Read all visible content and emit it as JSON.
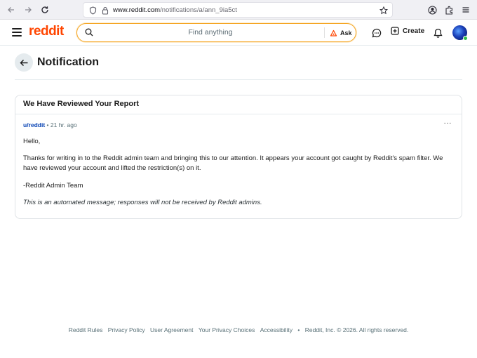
{
  "browser": {
    "url_host": "www.reddit.com",
    "url_path": "/notifications/a/ann_9ia5ct"
  },
  "header": {
    "logo": "reddit",
    "search_placeholder": "Find anything",
    "ask_label": "Ask",
    "create_label": "Create"
  },
  "page": {
    "title": "Notification"
  },
  "notification": {
    "title": "We Have Reviewed Your Report",
    "author": "u/reddit",
    "separator": "•",
    "time": "21 hr. ago",
    "more": "···",
    "greeting": "Hello,",
    "body": "Thanks for writing in to the Reddit admin team and bringing this to our attention. It appears your account got caught by Reddit's spam filter. We have reviewed your account and lifted the restriction(s) on it.",
    "signature": "-Reddit Admin Team",
    "disclaimer": "This is an automated message; responses will not be received by Reddit admins."
  },
  "footer": {
    "links": [
      "Reddit Rules",
      "Privacy Policy",
      "User Agreement",
      "Your Privacy Choices",
      "Accessibility"
    ],
    "separator": "•",
    "copyright": "Reddit, Inc. © 2026. All rights reserved."
  },
  "colors": {
    "brand": "#ff4500",
    "search_focus": "#f5a623",
    "link": "#0a45b5"
  }
}
